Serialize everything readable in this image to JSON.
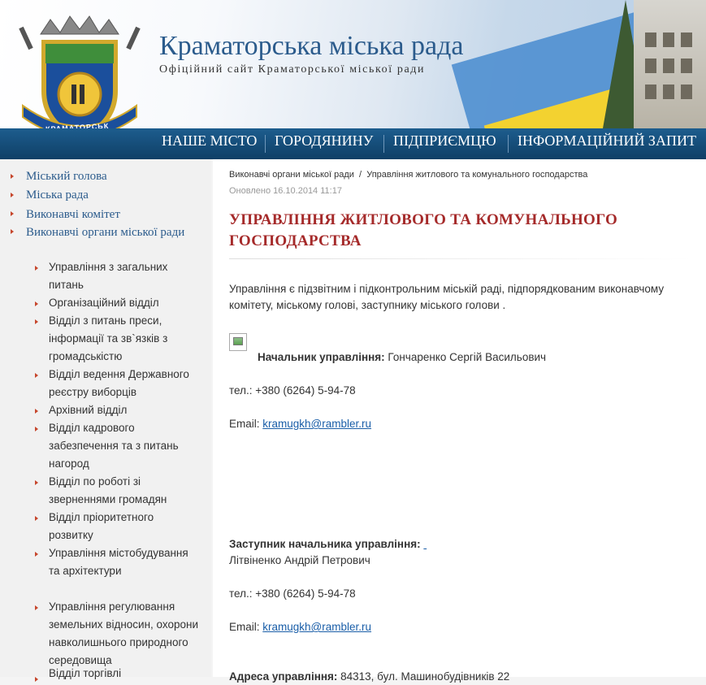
{
  "header": {
    "site_title": "Краматорська міська рада",
    "site_subtitle": "Офіційний сайт Краматорської міської ради",
    "logo_text": "КРАМАТОРСЬК"
  },
  "nav": [
    "НАШЕ МІСТО",
    "ГОРОДЯНИНУ",
    "ПІДПРИЄМЦЮ",
    "ІНФОРМАЦІЙНИЙ ЗАПИТ"
  ],
  "sidebar": {
    "top_items": [
      "Міський голова",
      "Міська рада",
      "Виконавчі комітет",
      "Виконавчі органи міської ради"
    ],
    "sub_items": [
      "Управління з загальних питань",
      "Організаційний відділ",
      "Відділ з питань преси, інформації та зв`язків з громадськістю",
      "Відділ ведення Державного реєстру виборців",
      "Архівний відділ",
      "Відділ кадрового забезпечення та з питань нагород",
      "Відділ по роботі зі зверненнями громадян",
      "Відділ пріоритетного розвитку",
      "Управління містобудування та архітектури",
      "Управління регулювання земельних відносин, охорони навколишнього природного середовища",
      "Відділ торгівлі"
    ]
  },
  "content": {
    "breadcrumb": [
      "Виконавчі органи міської ради",
      "/",
      "Управління житлового та комунального господарства"
    ],
    "updated": "Оновлено 16.10.2014 11:17",
    "title": "УПРАВЛІННЯ ЖИТЛОВОГО ТА КОМУНАЛЬНОГО ГОСПОДАРСТВА",
    "intro": "Управління є підзвітним і підконтрольним міській раді, підпорядкованим виконавчому комітету, міському голові, заступнику міського голови .",
    "head_label": "Начальник управління:",
    "head_name": "Гончаренко Сергій Васильович",
    "phone1": "тел.: +380 (6264) 5-94-78",
    "email_label": "Email:",
    "email1": "kramugkh@rambler.ru",
    "deputy_label": "Заступник начальника управління:",
    "deputy_name": "Літвіненко Андрій Петрович",
    "phone2": "тел.: +380 (6264) 5-94-78",
    "email2": "kramugkh@rambler.ru",
    "address_label": "Адреса управління:",
    "address": "84313, бул. Машинобудівників 22"
  }
}
